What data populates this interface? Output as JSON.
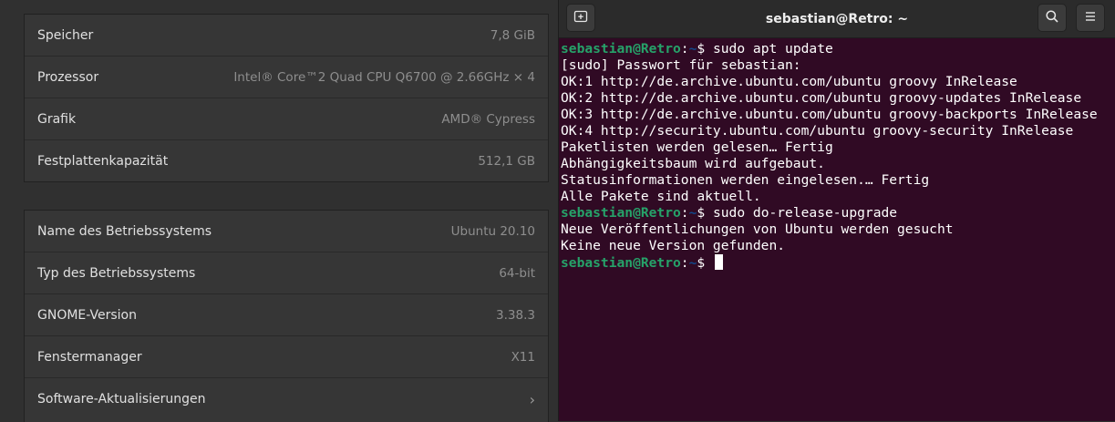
{
  "settings": {
    "hardware": [
      {
        "label": "Speicher",
        "value": "7,8 GiB"
      },
      {
        "label": "Prozessor",
        "value": "Intel® Core™2 Quad CPU Q6700 @ 2.66GHz × 4"
      },
      {
        "label": "Grafik",
        "value": "AMD® Cypress"
      },
      {
        "label": "Festplattenkapazität",
        "value": "512,1 GB"
      }
    ],
    "software": [
      {
        "label": "Name des Betriebssystems",
        "value": "Ubuntu 20.10"
      },
      {
        "label": "Typ des Betriebssystems",
        "value": "64-bit"
      },
      {
        "label": "GNOME-Version",
        "value": "3.38.3"
      },
      {
        "label": "Fenstermanager",
        "value": "X11"
      },
      {
        "label": "Software-Aktualisierungen",
        "chevron": "›"
      }
    ]
  },
  "terminal": {
    "title": "sebastian@Retro: ~",
    "icons": {
      "new_tab": "new-tab-icon",
      "search": "search-icon",
      "menu": "hamburger-menu-icon"
    },
    "prompt": {
      "user": "sebastian@Retro",
      "sep": ":",
      "path": "~",
      "sign": "$"
    },
    "lines": [
      {
        "type": "cmd",
        "text": " sudo apt update"
      },
      {
        "type": "out",
        "text": "[sudo] Passwort für sebastian:"
      },
      {
        "type": "out",
        "text": "OK:1 http://de.archive.ubuntu.com/ubuntu groovy InRelease"
      },
      {
        "type": "out",
        "text": "OK:2 http://de.archive.ubuntu.com/ubuntu groovy-updates InRelease"
      },
      {
        "type": "out",
        "text": "OK:3 http://de.archive.ubuntu.com/ubuntu groovy-backports InRelease"
      },
      {
        "type": "out",
        "text": "OK:4 http://security.ubuntu.com/ubuntu groovy-security InRelease"
      },
      {
        "type": "out",
        "text": "Paketlisten werden gelesen… Fertig"
      },
      {
        "type": "out",
        "text": "Abhängigkeitsbaum wird aufgebaut."
      },
      {
        "type": "out",
        "text": "Statusinformationen werden eingelesen.… Fertig"
      },
      {
        "type": "out",
        "text": "Alle Pakete sind aktuell."
      },
      {
        "type": "cmd",
        "text": " sudo do-release-upgrade"
      },
      {
        "type": "out",
        "text": "Neue Veröffentlichungen von Ubuntu werden gesucht"
      },
      {
        "type": "out",
        "text": "Keine neue Version gefunden."
      },
      {
        "type": "cmd",
        "text": " ",
        "cursor": true
      }
    ],
    "colors": {
      "background": "#300a24",
      "prompt_user": "#26a269",
      "prompt_path": "#12488b"
    }
  }
}
